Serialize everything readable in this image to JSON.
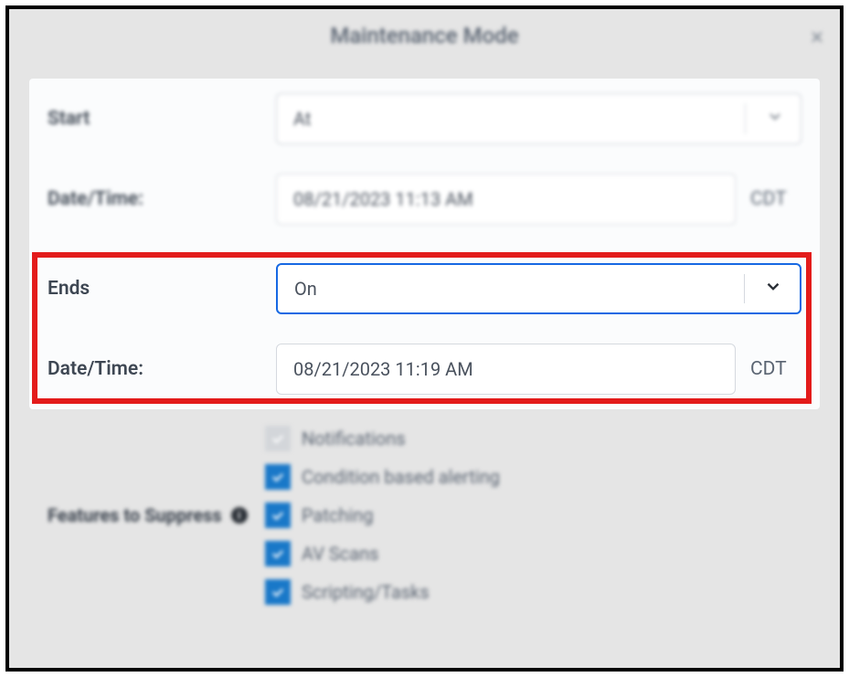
{
  "dialog": {
    "title": "Maintenance Mode"
  },
  "start": {
    "label": "Start",
    "select_value": "At",
    "datetime_label": "Date/Time:",
    "datetime_value": "08/21/2023 11:13 AM",
    "tz": "CDT"
  },
  "ends": {
    "label": "Ends",
    "select_value": "On",
    "datetime_label": "Date/Time:",
    "datetime_value": "08/21/2023 11:19 AM",
    "tz": "CDT"
  },
  "features": {
    "label": "Features to Suppress",
    "items": [
      {
        "label": "Notifications",
        "checked": true,
        "disabled": true
      },
      {
        "label": "Condition based alerting",
        "checked": true,
        "disabled": false
      },
      {
        "label": "Patching",
        "checked": true,
        "disabled": false
      },
      {
        "label": "AV Scans",
        "checked": true,
        "disabled": false
      },
      {
        "label": "Scripting/Tasks",
        "checked": true,
        "disabled": false
      }
    ]
  }
}
